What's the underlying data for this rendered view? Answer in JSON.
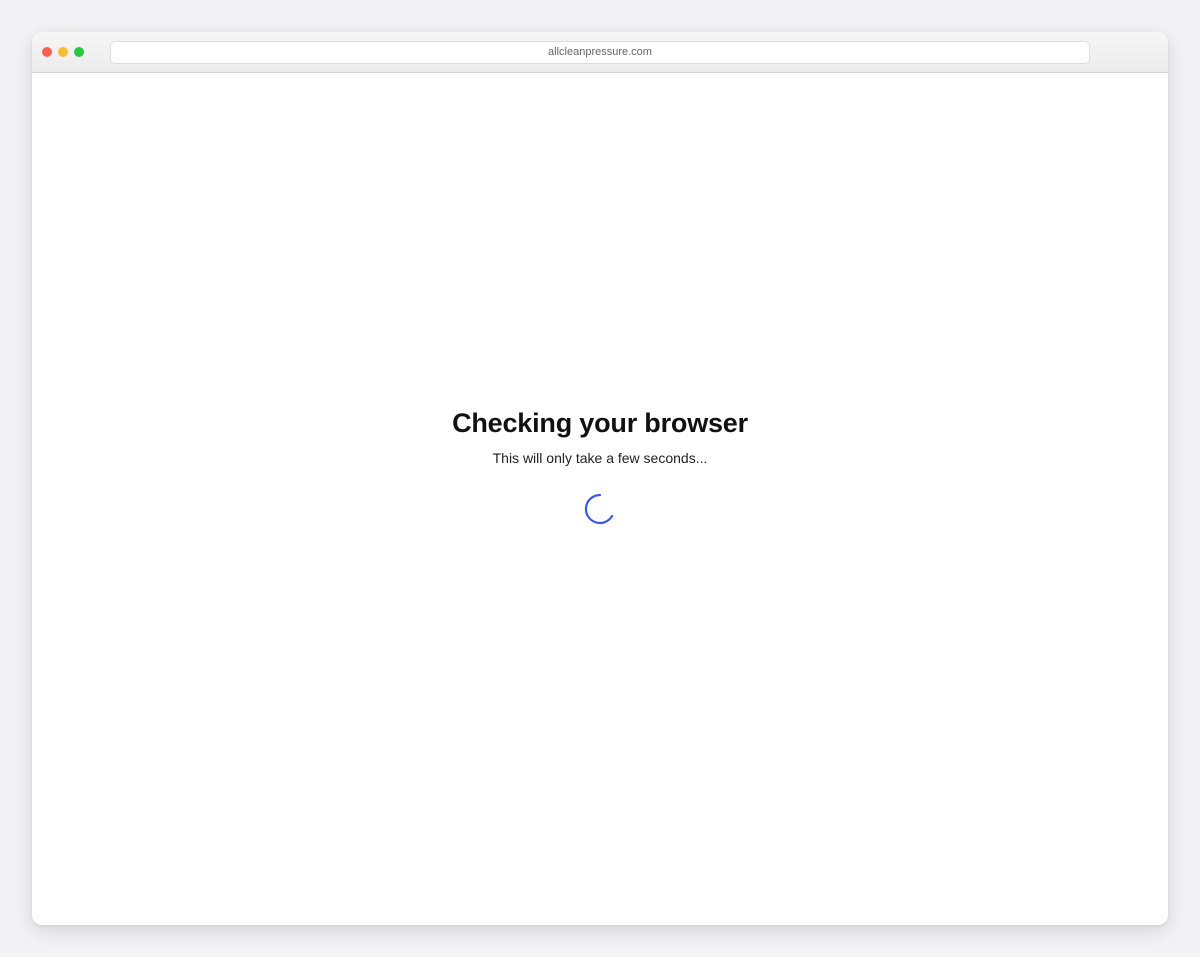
{
  "browser": {
    "url": "allcleanpressure.com"
  },
  "page": {
    "title": "Checking your browser",
    "subtitle": "This will only take a few seconds..."
  },
  "colors": {
    "spinner": "#3b5bdb",
    "close_button": "#fe5f57",
    "minimize_button": "#febc2e",
    "maximize_button": "#28c840"
  },
  "icons": {
    "spinner": "loading-spinner-icon"
  }
}
